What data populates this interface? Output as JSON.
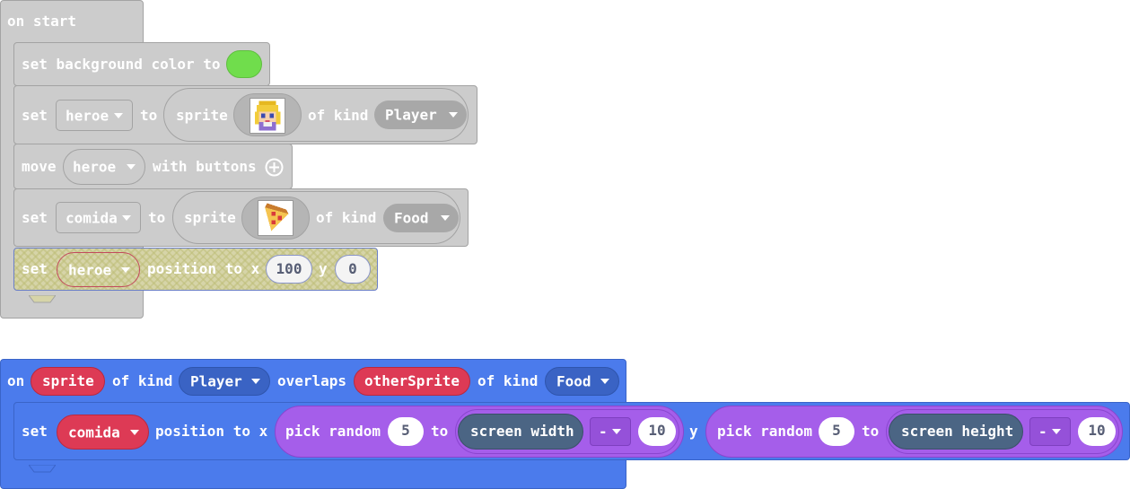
{
  "on_start": {
    "hat_label": "on start",
    "bg": {
      "set_label": "set background color to",
      "color": "#70dd4c"
    },
    "heroe_block": {
      "set_label": "set",
      "var_name": "heroe",
      "to_label": "to",
      "sprite_label": "sprite",
      "sprite_icon": "princess-sprite-icon",
      "of_kind_label": "of kind",
      "kind": "Player"
    },
    "move_block": {
      "move_label": "move",
      "var_name": "heroe",
      "with_buttons_label": "with buttons",
      "expand_icon": "plus-icon"
    },
    "comida_block": {
      "set_label": "set",
      "var_name": "comida",
      "to_label": "to",
      "sprite_label": "sprite",
      "sprite_icon": "pizza-sprite-icon",
      "of_kind_label": "of kind",
      "kind": "Food"
    },
    "position_block": {
      "set_label": "set",
      "var_name": "heroe",
      "position_to_x_label": "position to x",
      "x_value": "100",
      "y_label": "y",
      "y_value": "0"
    }
  },
  "overlap_event": {
    "on_label": "on",
    "sprite_param": "sprite",
    "of_kind_label_1": "of kind",
    "kind_1": "Player",
    "overlaps_label": "overlaps",
    "other_param": "otherSprite",
    "of_kind_label_2": "of kind",
    "kind_2": "Food",
    "set_label": "set",
    "var_name": "comida",
    "position_to_x_label": "position to x",
    "pick_random_label_1": "pick random",
    "min_1": "5",
    "to_label_1": "to",
    "screen_width_label": "screen width",
    "op_1": "-",
    "sub_1": "10",
    "y_label": "y",
    "pick_random_label_2": "pick random",
    "min_2": "5",
    "to_label_2": "to",
    "screen_height_label": "screen height",
    "op_2": "-",
    "sub_2": "10"
  },
  "colors": {
    "gray_block": "#cccccc",
    "sprites_blue": "#4b7bec",
    "variable_red": "#dd3a55",
    "math_purple": "#a55eea",
    "scene_slate": "#4b6584",
    "background_green": "#70dd4c"
  }
}
